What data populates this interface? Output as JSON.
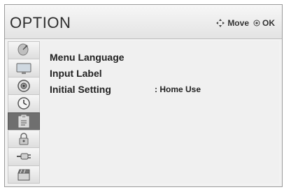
{
  "header": {
    "title": "OPTION",
    "hint_move": "Move",
    "hint_ok": "OK"
  },
  "sidebar": {
    "items": [
      {
        "icon": "satellite-dish-icon",
        "active": false
      },
      {
        "icon": "monitor-icon",
        "active": false
      },
      {
        "icon": "speaker-icon",
        "active": false
      },
      {
        "icon": "clock-icon",
        "active": false
      },
      {
        "icon": "option-clipboard-icon",
        "active": true
      },
      {
        "icon": "lock-icon",
        "active": false
      },
      {
        "icon": "input-plug-icon",
        "active": false
      },
      {
        "icon": "film-clapper-icon",
        "active": false
      }
    ]
  },
  "menu": {
    "items": [
      {
        "label": "Menu Language",
        "value": ""
      },
      {
        "label": "Input Label",
        "value": ""
      },
      {
        "label": "Initial Setting",
        "value": ": Home Use"
      }
    ]
  },
  "colors": {
    "active_sidebar": "#6f6f6f",
    "header_bg": "#e8e8e8"
  }
}
